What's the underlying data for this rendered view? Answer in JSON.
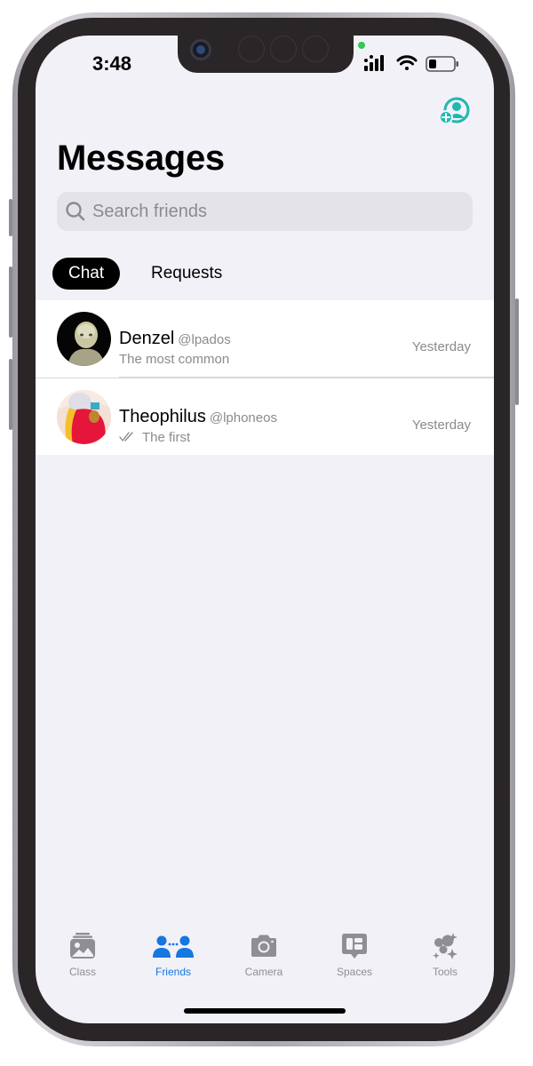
{
  "status_bar": {
    "time": "3:48"
  },
  "header": {
    "title": "Messages",
    "add_friend_icon": "person-add-icon"
  },
  "search": {
    "placeholder": "Search friends",
    "value": ""
  },
  "tabs": [
    {
      "label": "Chat",
      "active": true
    },
    {
      "label": "Requests",
      "active": false
    }
  ],
  "chats": [
    {
      "name": "Denzel",
      "handle": "@lpados",
      "preview": "The most common",
      "time": "Yesterday",
      "read_receipt": false
    },
    {
      "name": "Theophilus",
      "handle": "@lphoneos",
      "preview": "The first",
      "time": "Yesterday",
      "read_receipt": true
    }
  ],
  "tabbar": [
    {
      "label": "Class",
      "icon": "photo-stack-icon",
      "active": false
    },
    {
      "label": "Friends",
      "icon": "people-icon",
      "active": true
    },
    {
      "label": "Camera",
      "icon": "camera-icon",
      "active": false
    },
    {
      "label": "Spaces",
      "icon": "chat-bubble-icon",
      "active": false
    },
    {
      "label": "Tools",
      "icon": "sparkles-icon",
      "active": false
    }
  ],
  "colors": {
    "accent": "#1577e0",
    "teal": "#1fb8b0",
    "screen_bg": "#f2f1f7",
    "inactive_gray": "#8e8e93"
  }
}
